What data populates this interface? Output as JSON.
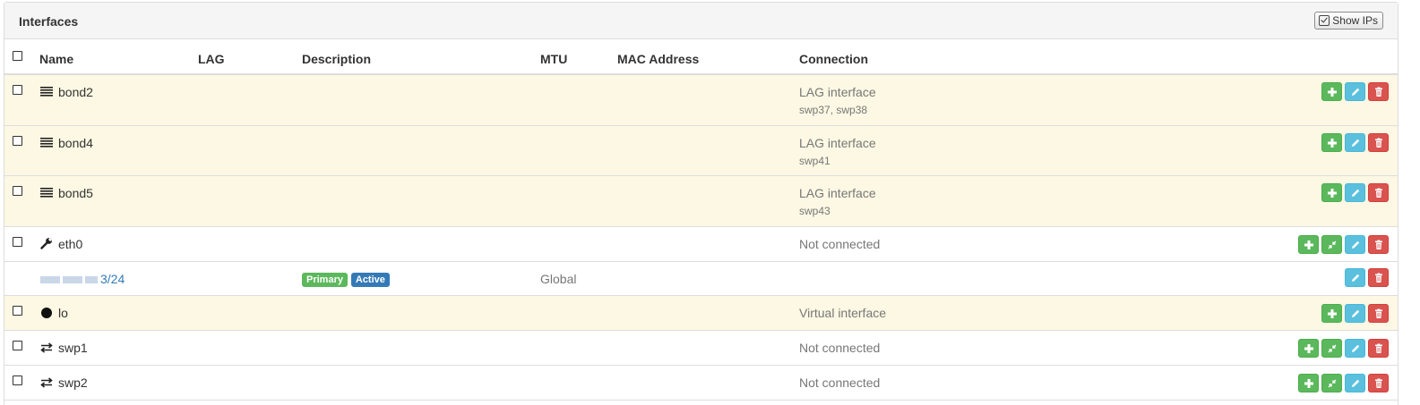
{
  "panel": {
    "title": "Interfaces",
    "show_ips_label": "Show IPs"
  },
  "columns": {
    "name": "Name",
    "lag": "LAG",
    "description": "Description",
    "mtu": "MTU",
    "mac": "MAC Address",
    "connection": "Connection"
  },
  "rows": [
    {
      "name": "bond2",
      "icon": "bond-icon",
      "connection": "LAG interface",
      "connection_sub": "swp37, swp38",
      "highlight": true
    },
    {
      "name": "bond4",
      "icon": "bond-icon",
      "connection": "LAG interface",
      "connection_sub": "swp41",
      "highlight": true
    },
    {
      "name": "bond5",
      "icon": "bond-icon",
      "connection": "LAG interface",
      "connection_sub": "swp43",
      "highlight": true
    },
    {
      "name": "eth0",
      "icon": "wrench-icon",
      "connection": "Not connected",
      "highlight": false
    },
    {
      "name": "lo",
      "icon": "circle-icon",
      "connection": "Virtual interface",
      "highlight": true
    },
    {
      "name": "swp1",
      "icon": "exchange-icon",
      "connection": "Not connected",
      "highlight": false
    },
    {
      "name": "swp2",
      "icon": "exchange-icon",
      "connection": "Not connected",
      "highlight": false
    }
  ],
  "ip_row": {
    "address_suffix": "3/24",
    "badge_primary": "Primary",
    "badge_active": "Active",
    "vrf": "Global"
  },
  "colors": {
    "success": "#5cb85c",
    "info": "#5bc0de",
    "danger": "#d9534f",
    "primary": "#337ab7",
    "warning_bg": "#fcf8e3"
  }
}
